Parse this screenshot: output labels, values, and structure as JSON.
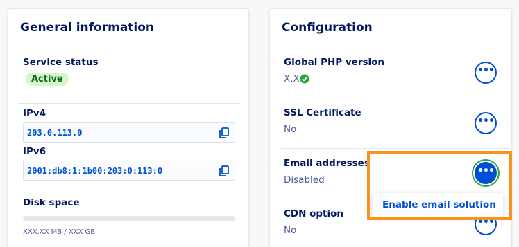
{
  "general": {
    "title": "General information",
    "service_status_label": "Service status",
    "service_status_value": "Active",
    "ipv4_label": "IPv4",
    "ipv4_value": "203.0.113.0",
    "ipv6_label": "IPv6",
    "ipv6_value": "2001:db8:1:1b00:203:0:113:0",
    "disk_label": "Disk space",
    "disk_usage_text": "XXX.XX MB / XXX GB"
  },
  "configuration": {
    "title": "Configuration",
    "php_label": "Global PHP version",
    "php_value": "X.X",
    "ssl_label": "SSL Certificate",
    "ssl_value": "No",
    "email_label": "Email addresses",
    "email_value": "Disabled",
    "email_menu_item": "Enable email solution",
    "cdn_label": "CDN option",
    "cdn_value": "No",
    "action_glyph": "•••"
  },
  "icons": [
    "copy-icon",
    "check-circle-icon",
    "more-actions-icon"
  ],
  "colors": {
    "accent": "#0050d7",
    "title": "#00185e",
    "status_active_bg": "#d7f5c9",
    "status_active_text": "#0a6a15",
    "check_green": "#2aa53b",
    "highlight": "#f7931e"
  }
}
